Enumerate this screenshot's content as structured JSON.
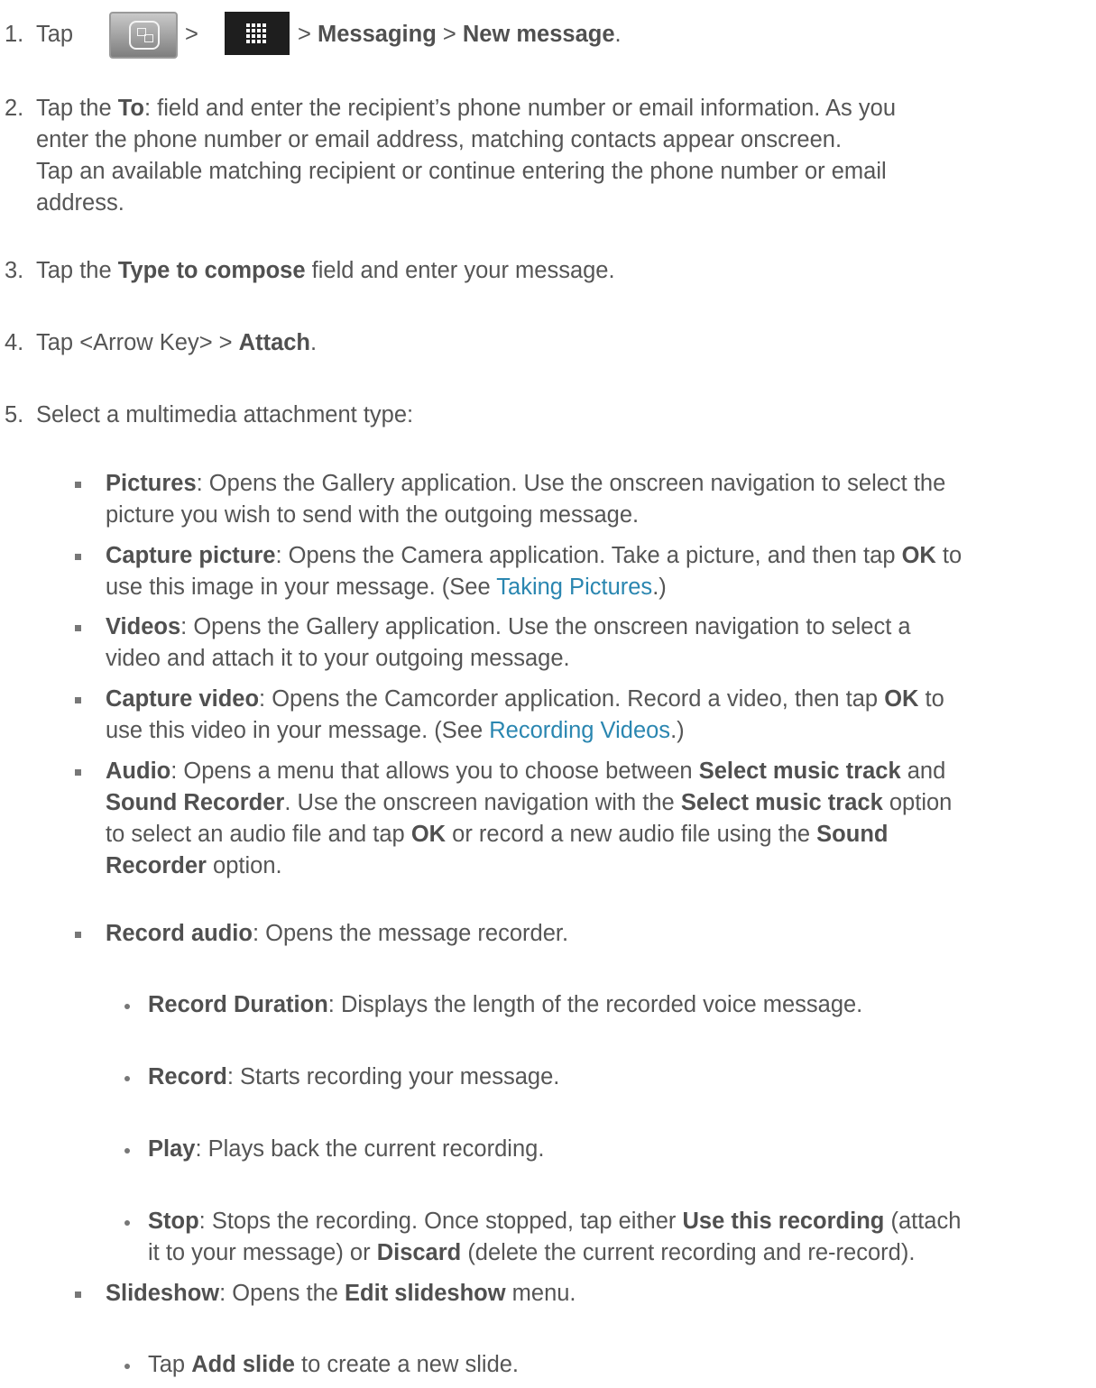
{
  "steps": [
    {
      "num": "1.",
      "tap": "Tap",
      "icons": [
        "home-button-icon",
        "applications-grid-icon"
      ],
      "gt1": ">",
      "gt2": "> ",
      "b1": "Messaging",
      "gt3": " > ",
      "b2": "New message",
      "end": "."
    },
    {
      "num": "2.",
      "l1_pre": "Tap the ",
      "l1_b": "To",
      "l1_post": ": field and enter the recipient’s phone number or email information. As you",
      "l2": "enter the phone number or email address, matching contacts appear onscreen.",
      "l3": "Tap an available matching recipient or continue entering the phone number or email",
      "l4": "address."
    },
    {
      "num": "3.",
      "pre": "Tap the ",
      "b": "Type to compose",
      "post": " field and enter your message."
    },
    {
      "num": "4.",
      "pre": "Tap <Arrow Key> > ",
      "b": "Attach",
      "post": "."
    },
    {
      "num": "5.",
      "text": "Select a multimedia attachment type:"
    }
  ],
  "attachments": {
    "pictures": {
      "b": "Pictures",
      "l1": ": Opens the Gallery application. Use the onscreen navigation to select the",
      "l2": "picture you wish to send with the outgoing message."
    },
    "capture_picture": {
      "b": "Capture picture",
      "l1_a": ": Opens the Camera application. Take a picture, and then tap ",
      "l1_b": "OK",
      "l1_c": " to",
      "l2_a": "use this image in your message. (See ",
      "l2_link": "Taking Pictures",
      "l2_c": ".)"
    },
    "videos": {
      "b": "Videos",
      "l1": ": Opens the Gallery application. Use the onscreen navigation to select a",
      "l2": "video and attach it to your outgoing message."
    },
    "capture_video": {
      "b": "Capture video",
      "l1_a": ": Opens the Camcorder application. Record a video, then tap ",
      "l1_b": "OK",
      "l1_c": " to",
      "l2_a": "use this video in your message. (See ",
      "l2_link": "Recording Videos",
      "l2_c": ".)"
    },
    "audio": {
      "b": "Audio",
      "l1_a": ": Opens a menu that allows you to choose between ",
      "l1_b": "Select music track",
      "l1_c": " and",
      "l2_b1": "Sound Recorder",
      "l2_a": ". Use the onscreen navigation with the ",
      "l2_b2": "Select music track",
      "l2_c": " option",
      "l3_a": "to select an audio file and tap ",
      "l3_b1": "OK",
      "l3_c": " or record a new audio file using the ",
      "l3_b2": "Sound",
      "l4_b": "Recorder",
      "l4_c": " option."
    },
    "record_audio": {
      "b": "Record audio",
      "text": ": Opens the message recorder.",
      "sub": {
        "duration": {
          "b": "Record Duration",
          "text": ": Displays the length of the recorded voice message."
        },
        "record": {
          "b": "Record",
          "text": ": Starts recording your message."
        },
        "play": {
          "b": "Play",
          "text": ": Plays back the current recording."
        },
        "stop": {
          "b": "Stop",
          "l1_a": ": Stops the recording. Once stopped, tap either ",
          "l1_b": "Use this recording",
          "l1_c": " (attach",
          "l2_a": "it to your message) or ",
          "l2_b": "Discard",
          "l2_c": " (delete the current recording and re-record)."
        }
      }
    },
    "slideshow": {
      "b": "Slideshow",
      "a": ": Opens the ",
      "b2": "Edit slideshow",
      "c": " menu.",
      "sub": {
        "add_slide": {
          "pre": "Tap ",
          "b": "Add slide",
          "post": " to create a new slide."
        }
      }
    }
  },
  "colors": {
    "text": "#555555",
    "bold": "#505050",
    "link": "#2a86b0",
    "bullet": "#777777"
  }
}
